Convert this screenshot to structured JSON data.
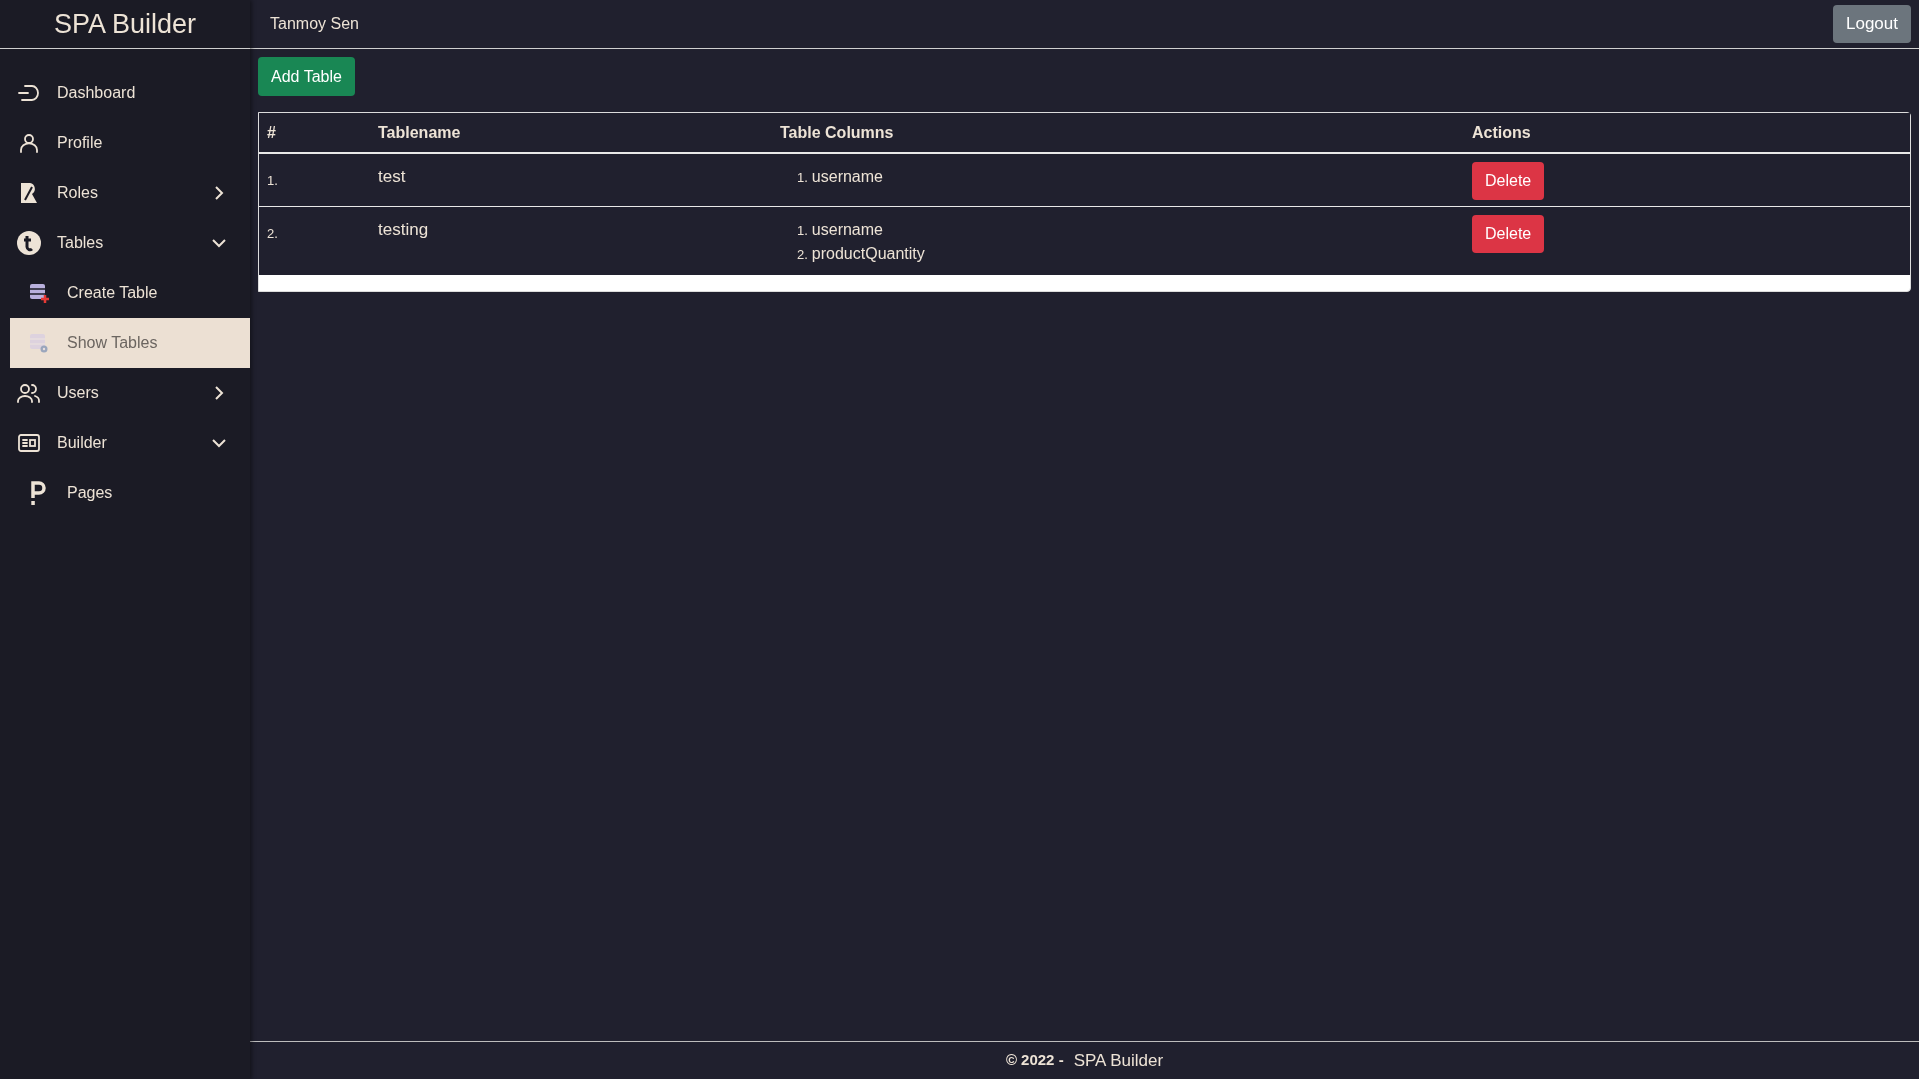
{
  "app": {
    "title": "SPA Builder"
  },
  "header": {
    "user": "Tanmoy Sen",
    "logout": "Logout"
  },
  "sidebar": {
    "items": [
      {
        "label": "Dashboard",
        "selected": false
      },
      {
        "label": "Profile",
        "selected": false
      },
      {
        "label": "Roles",
        "selected": false,
        "expanded": false
      },
      {
        "label": "Tables",
        "selected": false,
        "expanded": true,
        "children": [
          {
            "label": "Create Table",
            "selected": false
          },
          {
            "label": "Show Tables",
            "selected": true
          }
        ]
      },
      {
        "label": "Users",
        "selected": false,
        "expanded": false
      },
      {
        "label": "Builder",
        "selected": false,
        "expanded": true,
        "children": [
          {
            "label": "Pages",
            "selected": false
          }
        ]
      }
    ]
  },
  "toolbar": {
    "add_button": "Add Table"
  },
  "table": {
    "columns": [
      "#",
      "Tablename",
      "Table Columns",
      "Actions"
    ],
    "rows": [
      {
        "index": "1.",
        "name": "test",
        "columns": [
          {
            "number": "1.",
            "name": "username"
          }
        ],
        "action": "Delete"
      },
      {
        "index": "2.",
        "name": "testing",
        "columns": [
          {
            "number": "1.",
            "name": "username"
          },
          {
            "number": "2.",
            "name": "productQuantity"
          }
        ],
        "action": "Delete"
      }
    ]
  },
  "footer": {
    "copyright": "© 2022 -",
    "brand": "SPA Builder"
  }
}
